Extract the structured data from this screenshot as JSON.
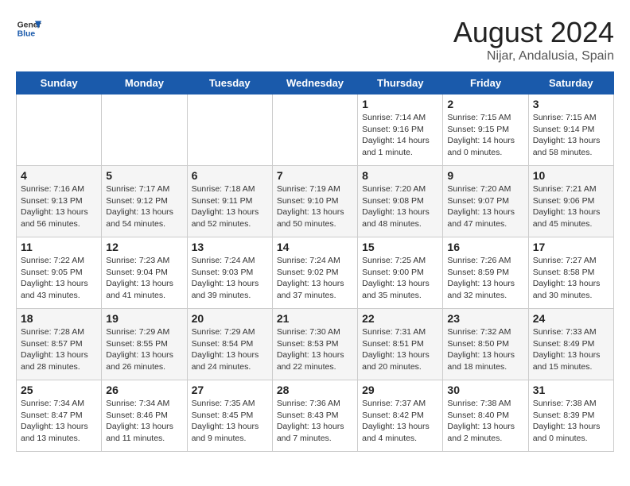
{
  "header": {
    "logo_general": "General",
    "logo_blue": "Blue",
    "title": "August 2024",
    "subtitle": "Nijar, Andalusia, Spain"
  },
  "days_of_week": [
    "Sunday",
    "Monday",
    "Tuesday",
    "Wednesday",
    "Thursday",
    "Friday",
    "Saturday"
  ],
  "weeks": [
    [
      {
        "day": "",
        "info": ""
      },
      {
        "day": "",
        "info": ""
      },
      {
        "day": "",
        "info": ""
      },
      {
        "day": "",
        "info": ""
      },
      {
        "day": "1",
        "sunrise": "7:14 AM",
        "sunset": "9:16 PM",
        "daylight": "14 hours and 1 minute."
      },
      {
        "day": "2",
        "sunrise": "7:15 AM",
        "sunset": "9:15 PM",
        "daylight": "14 hours and 0 minutes."
      },
      {
        "day": "3",
        "sunrise": "7:15 AM",
        "sunset": "9:14 PM",
        "daylight": "13 hours and 58 minutes."
      }
    ],
    [
      {
        "day": "4",
        "sunrise": "7:16 AM",
        "sunset": "9:13 PM",
        "daylight": "13 hours and 56 minutes."
      },
      {
        "day": "5",
        "sunrise": "7:17 AM",
        "sunset": "9:12 PM",
        "daylight": "13 hours and 54 minutes."
      },
      {
        "day": "6",
        "sunrise": "7:18 AM",
        "sunset": "9:11 PM",
        "daylight": "13 hours and 52 minutes."
      },
      {
        "day": "7",
        "sunrise": "7:19 AM",
        "sunset": "9:10 PM",
        "daylight": "13 hours and 50 minutes."
      },
      {
        "day": "8",
        "sunrise": "7:20 AM",
        "sunset": "9:08 PM",
        "daylight": "13 hours and 48 minutes."
      },
      {
        "day": "9",
        "sunrise": "7:20 AM",
        "sunset": "9:07 PM",
        "daylight": "13 hours and 47 minutes."
      },
      {
        "day": "10",
        "sunrise": "7:21 AM",
        "sunset": "9:06 PM",
        "daylight": "13 hours and 45 minutes."
      }
    ],
    [
      {
        "day": "11",
        "sunrise": "7:22 AM",
        "sunset": "9:05 PM",
        "daylight": "13 hours and 43 minutes."
      },
      {
        "day": "12",
        "sunrise": "7:23 AM",
        "sunset": "9:04 PM",
        "daylight": "13 hours and 41 minutes."
      },
      {
        "day": "13",
        "sunrise": "7:24 AM",
        "sunset": "9:03 PM",
        "daylight": "13 hours and 39 minutes."
      },
      {
        "day": "14",
        "sunrise": "7:24 AM",
        "sunset": "9:02 PM",
        "daylight": "13 hours and 37 minutes."
      },
      {
        "day": "15",
        "sunrise": "7:25 AM",
        "sunset": "9:00 PM",
        "daylight": "13 hours and 35 minutes."
      },
      {
        "day": "16",
        "sunrise": "7:26 AM",
        "sunset": "8:59 PM",
        "daylight": "13 hours and 32 minutes."
      },
      {
        "day": "17",
        "sunrise": "7:27 AM",
        "sunset": "8:58 PM",
        "daylight": "13 hours and 30 minutes."
      }
    ],
    [
      {
        "day": "18",
        "sunrise": "7:28 AM",
        "sunset": "8:57 PM",
        "daylight": "13 hours and 28 minutes."
      },
      {
        "day": "19",
        "sunrise": "7:29 AM",
        "sunset": "8:55 PM",
        "daylight": "13 hours and 26 minutes."
      },
      {
        "day": "20",
        "sunrise": "7:29 AM",
        "sunset": "8:54 PM",
        "daylight": "13 hours and 24 minutes."
      },
      {
        "day": "21",
        "sunrise": "7:30 AM",
        "sunset": "8:53 PM",
        "daylight": "13 hours and 22 minutes."
      },
      {
        "day": "22",
        "sunrise": "7:31 AM",
        "sunset": "8:51 PM",
        "daylight": "13 hours and 20 minutes."
      },
      {
        "day": "23",
        "sunrise": "7:32 AM",
        "sunset": "8:50 PM",
        "daylight": "13 hours and 18 minutes."
      },
      {
        "day": "24",
        "sunrise": "7:33 AM",
        "sunset": "8:49 PM",
        "daylight": "13 hours and 15 minutes."
      }
    ],
    [
      {
        "day": "25",
        "sunrise": "7:34 AM",
        "sunset": "8:47 PM",
        "daylight": "13 hours and 13 minutes."
      },
      {
        "day": "26",
        "sunrise": "7:34 AM",
        "sunset": "8:46 PM",
        "daylight": "13 hours and 11 minutes."
      },
      {
        "day": "27",
        "sunrise": "7:35 AM",
        "sunset": "8:45 PM",
        "daylight": "13 hours and 9 minutes."
      },
      {
        "day": "28",
        "sunrise": "7:36 AM",
        "sunset": "8:43 PM",
        "daylight": "13 hours and 7 minutes."
      },
      {
        "day": "29",
        "sunrise": "7:37 AM",
        "sunset": "8:42 PM",
        "daylight": "13 hours and 4 minutes."
      },
      {
        "day": "30",
        "sunrise": "7:38 AM",
        "sunset": "8:40 PM",
        "daylight": "13 hours and 2 minutes."
      },
      {
        "day": "31",
        "sunrise": "7:38 AM",
        "sunset": "8:39 PM",
        "daylight": "13 hours and 0 minutes."
      }
    ]
  ]
}
